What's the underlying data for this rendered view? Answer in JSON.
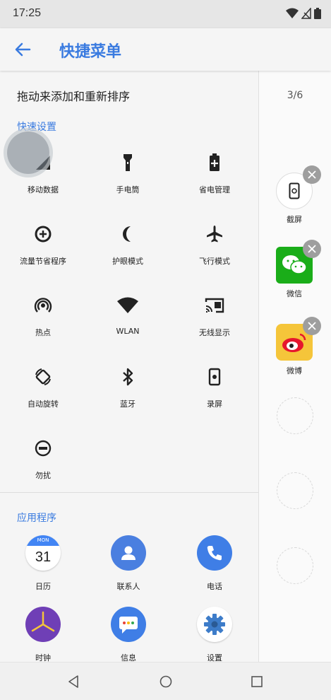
{
  "status_bar": {
    "time": "17:25"
  },
  "header": {
    "title": "快捷菜单"
  },
  "instruction": "拖动来添加和重新排序",
  "quick_settings": {
    "label": "快速设置",
    "items": [
      {
        "label": "移动数据",
        "icon": "cellular-signal-icon"
      },
      {
        "label": "手电筒",
        "icon": "flashlight-icon"
      },
      {
        "label": "省电管理",
        "icon": "battery-saver-icon"
      },
      {
        "label": "流量节省程序",
        "icon": "data-saver-icon"
      },
      {
        "label": "护眼模式",
        "icon": "moon-icon"
      },
      {
        "label": "飞行模式",
        "icon": "airplane-icon"
      },
      {
        "label": "热点",
        "icon": "hotspot-icon"
      },
      {
        "label": "WLAN",
        "icon": "wifi-icon"
      },
      {
        "label": "无线显示",
        "icon": "cast-icon"
      },
      {
        "label": "自动旋转",
        "icon": "auto-rotate-icon"
      },
      {
        "label": "蓝牙",
        "icon": "bluetooth-icon"
      },
      {
        "label": "录屏",
        "icon": "screen-record-icon"
      },
      {
        "label": "勿扰",
        "icon": "do-not-disturb-icon"
      }
    ]
  },
  "apps": {
    "label": "应用程序",
    "items": [
      {
        "label": "日历",
        "icon": "calendar-icon",
        "month": "MON",
        "day": "31",
        "color": "#4285f4"
      },
      {
        "label": "联系人",
        "icon": "contacts-icon",
        "color": "#4a7fe0"
      },
      {
        "label": "电话",
        "icon": "phone-icon",
        "color": "#3f7ee6"
      },
      {
        "label": "时钟",
        "icon": "clock-icon",
        "color": "#6f3fb6"
      },
      {
        "label": "信息",
        "icon": "messages-icon",
        "color": "#3f7ee6"
      },
      {
        "label": "设置",
        "icon": "settings-gear-icon",
        "color": "#3d7cc9"
      }
    ]
  },
  "selected_panel": {
    "page_indicator": "3/6",
    "items": [
      {
        "label": "截屏",
        "icon": "screenshot-icon"
      },
      {
        "label": "微信",
        "icon": "wechat-icon",
        "color": "#1aad19"
      },
      {
        "label": "微博",
        "icon": "weibo-icon",
        "color": "#f5c53a"
      }
    ],
    "empty_slots": 3
  },
  "colors": {
    "accent": "#3a7be0"
  }
}
